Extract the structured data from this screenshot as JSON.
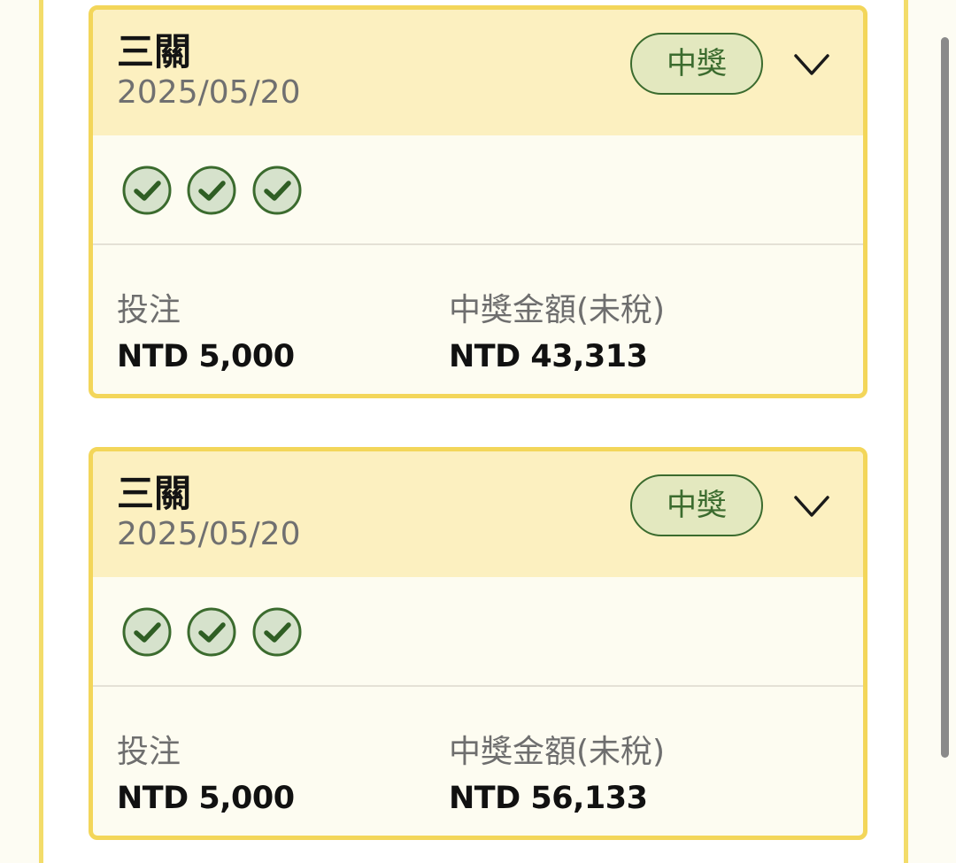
{
  "bets": [
    {
      "type": "三關",
      "date": "2025/05/20",
      "status": "中獎",
      "legs": [
        "won",
        "won",
        "won"
      ],
      "stake_label": "投注",
      "stake_value": "NTD 5,000",
      "winnings_label": "中獎金額(未稅)",
      "winnings_value": "NTD 43,313"
    },
    {
      "type": "三關",
      "date": "2025/05/20",
      "status": "中獎",
      "legs": [
        "won",
        "won",
        "won"
      ],
      "stake_label": "投注",
      "stake_value": "NTD 5,000",
      "winnings_label": "中獎金額(未稅)",
      "winnings_value": "NTD 56,133"
    }
  ],
  "icons": {
    "leg_status": "check-circle-icon",
    "expand": "chevron-down-icon"
  },
  "colors": {
    "accent_border": "#f3d65a",
    "header_background": "#fcf0c0",
    "win_green": "#3b6b2e",
    "badge_fill": "#e3e8bf"
  }
}
